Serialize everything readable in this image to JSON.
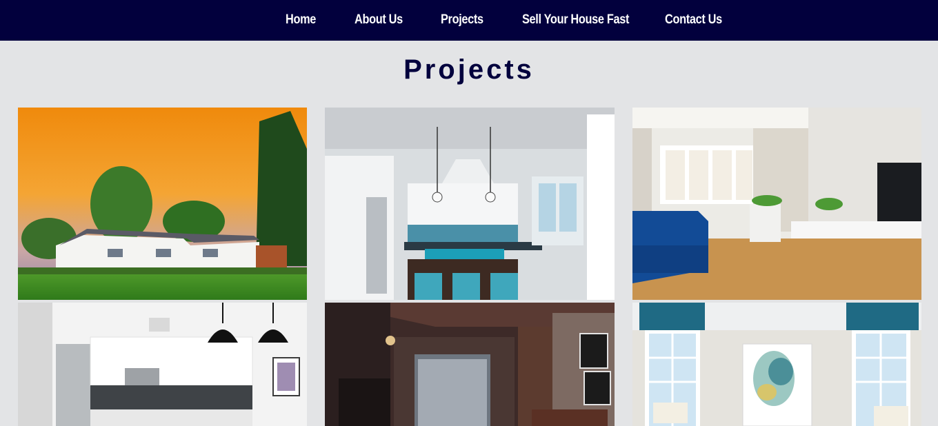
{
  "nav": {
    "items": [
      {
        "label": "Home"
      },
      {
        "label": "About Us"
      },
      {
        "label": "Projects"
      },
      {
        "label": "Sell Your House Fast"
      },
      {
        "label": "Contact Us"
      }
    ]
  },
  "page": {
    "title": "Projects"
  },
  "colors": {
    "navbar_bg": "#02003d",
    "page_bg": "#e3e4e6",
    "title": "#02003d"
  },
  "gallery": {
    "photos": [
      {
        "name": "house-exterior-photo"
      },
      {
        "name": "kitchen-island-photo"
      },
      {
        "name": "living-room-blue-sofa-photo"
      },
      {
        "name": "white-kitchen-pendant-photo"
      },
      {
        "name": "dark-wood-room-photo"
      },
      {
        "name": "bedroom-windows-art-photo"
      }
    ]
  }
}
